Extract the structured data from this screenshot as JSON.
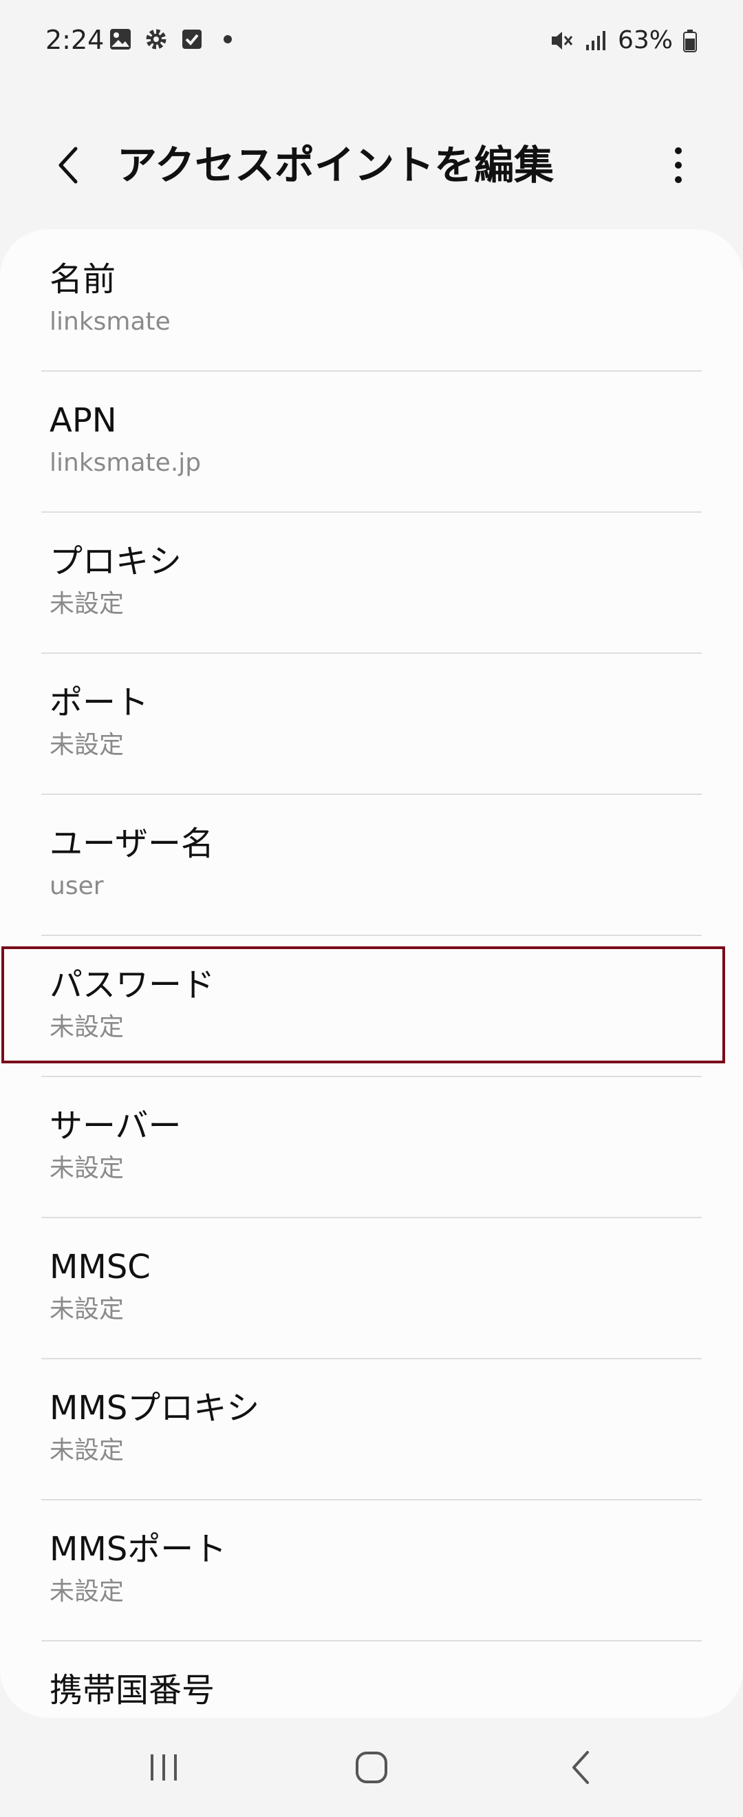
{
  "status_bar": {
    "time": "2:24",
    "battery": "63%",
    "icons_left": [
      "image-icon",
      "gear-icon",
      "checkbox-icon",
      "dot-icon"
    ],
    "icons_right": [
      "mute-icon",
      "signal-icon",
      "battery-icon"
    ]
  },
  "header": {
    "title": "アクセスポイントを編集"
  },
  "settings": [
    {
      "title": "名前",
      "value": "linksmate"
    },
    {
      "title": "APN",
      "value": "linksmate.jp"
    },
    {
      "title": "プロキシ",
      "value": "未設定"
    },
    {
      "title": "ポート",
      "value": "未設定"
    },
    {
      "title": "ユーザー名",
      "value": "user"
    },
    {
      "title": "パスワード",
      "value": "未設定"
    },
    {
      "title": "サーバー",
      "value": "未設定"
    },
    {
      "title": "MMSC",
      "value": "未設定"
    },
    {
      "title": "MMSプロキシ",
      "value": "未設定"
    },
    {
      "title": "MMSポート",
      "value": "未設定"
    },
    {
      "title": "携帯国番号",
      "value": ""
    }
  ],
  "colors": {
    "highlight": "#7a0c1a",
    "background": "#f4f4f4",
    "card": "#fcfcfc",
    "secondary_text": "#8a8a8a"
  },
  "nav_bar": {
    "icons": [
      "recent-apps-icon",
      "home-icon",
      "back-icon"
    ]
  }
}
